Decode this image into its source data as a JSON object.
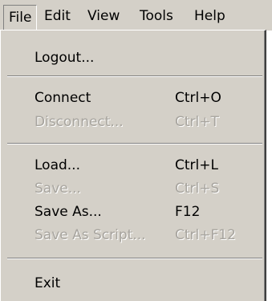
{
  "menubar": {
    "items": [
      {
        "label": "File"
      },
      {
        "label": "Edit"
      },
      {
        "label": "View"
      },
      {
        "label": "Tools"
      },
      {
        "label": "Help"
      }
    ]
  },
  "file_menu": {
    "logout": {
      "label": "Logout..."
    },
    "connect": {
      "label": "Connect",
      "shortcut": "Ctrl+O"
    },
    "disconnect": {
      "label": "Disconnect...",
      "shortcut": "Ctrl+T",
      "disabled": true
    },
    "load": {
      "label": "Load...",
      "shortcut": "Ctrl+L"
    },
    "save": {
      "label": "Save...",
      "shortcut": "Ctrl+S",
      "disabled": true
    },
    "save_as": {
      "label": "Save As...",
      "shortcut": "F12"
    },
    "save_as_script": {
      "label": "Save As Script...",
      "shortcut": "Ctrl+F12",
      "disabled": true
    },
    "exit": {
      "label": "Exit"
    }
  },
  "colors": {
    "face": "#d4d0c8",
    "disabled_text": "#a7a49e"
  }
}
